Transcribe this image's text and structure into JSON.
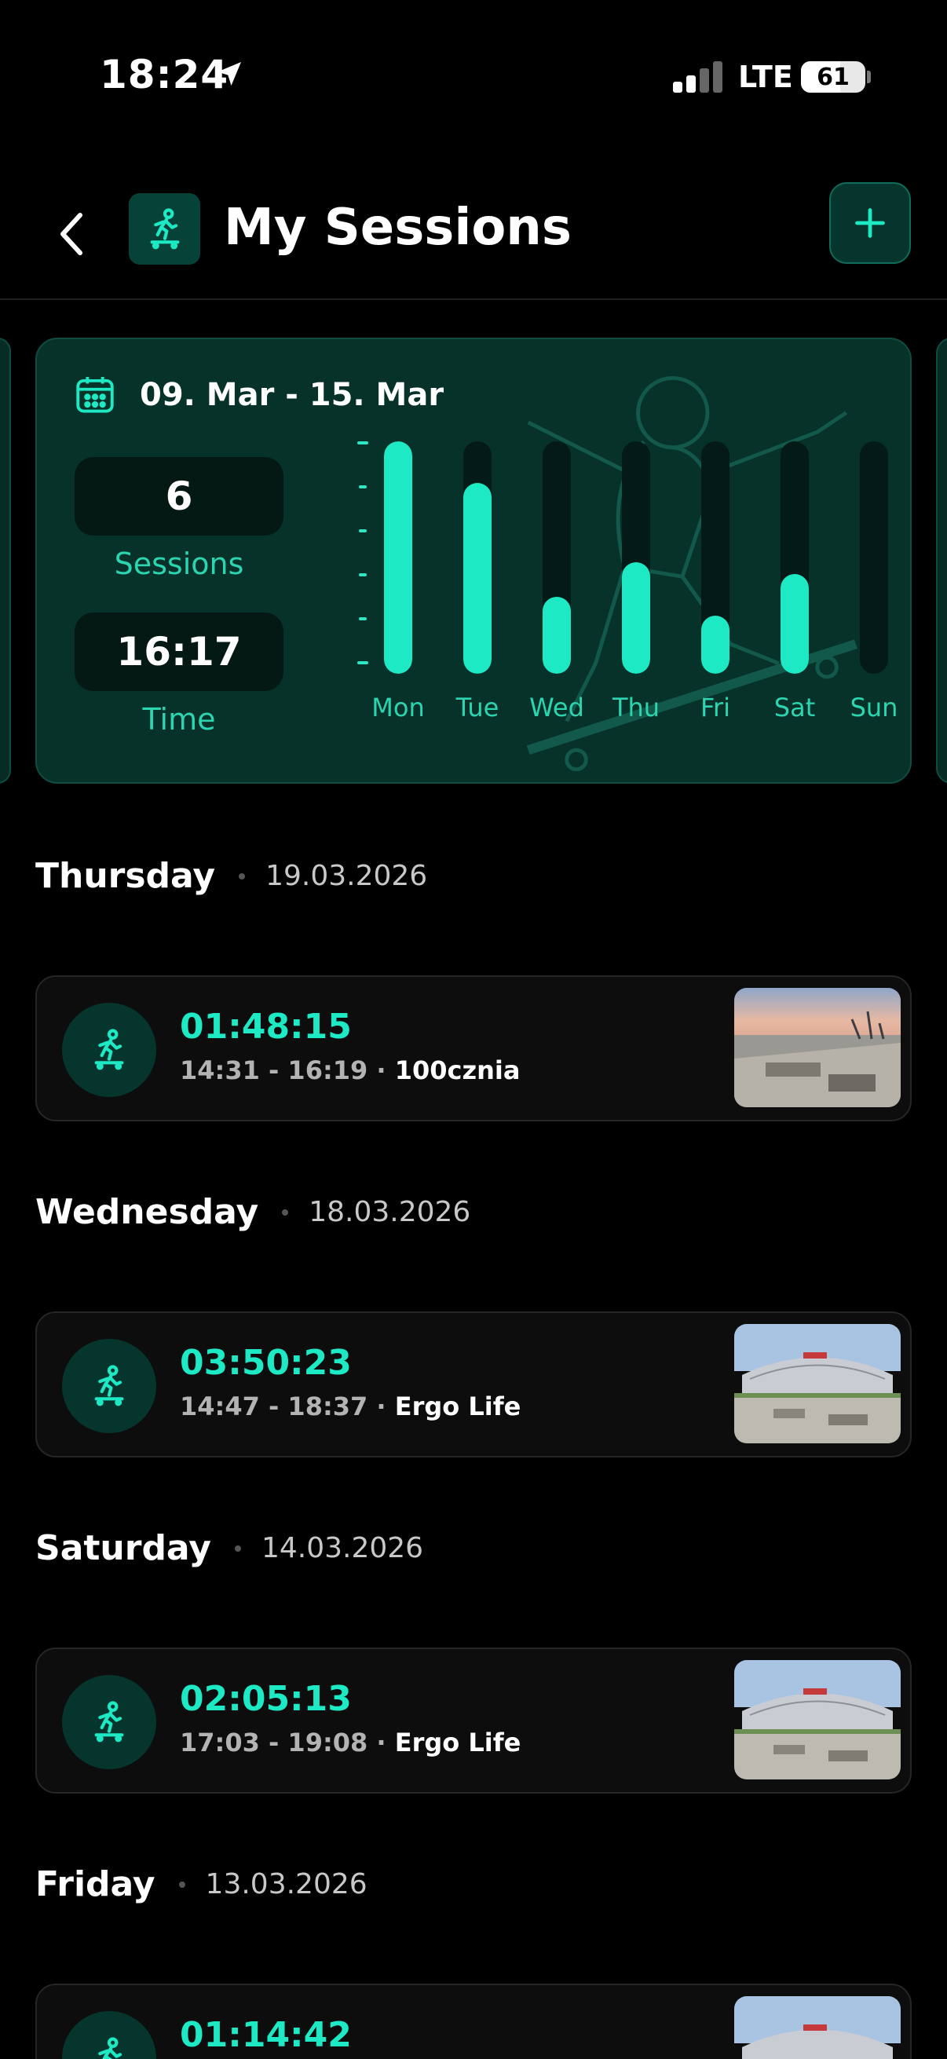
{
  "status_bar": {
    "time": "18:24",
    "network": "LTE",
    "battery": "61",
    "battery_level": 0.61,
    "icons": [
      "location-arrow-icon",
      "signal-bars-icon",
      "battery-icon"
    ]
  },
  "header": {
    "title": "My Sessions",
    "back_icon": "chevron-left-icon",
    "logo_icon": "skateboarder-icon",
    "add_icon": "plus-icon"
  },
  "summary": {
    "date_range": "09. Mar - 15. Mar",
    "calendar_icon": "calendar-icon",
    "sessions_value": "6",
    "sessions_label": "Sessions",
    "time_value": "16:17",
    "time_label": "Time"
  },
  "chart_data": {
    "type": "bar",
    "categories": [
      "Mon",
      "Tue",
      "Wed",
      "Thu",
      "Fri",
      "Sat",
      "Sun"
    ],
    "values": [
      1.0,
      0.82,
      0.33,
      0.48,
      0.25,
      0.43,
      0
    ],
    "ylim": [
      0,
      1
    ]
  },
  "sessions": [
    {
      "day": "Thursday",
      "date": "19.03.2026",
      "duration": "01:48:15",
      "range": "14:31 - 16:19 · ",
      "spot": "100cznia",
      "thumb": "waterfront-skatepark"
    },
    {
      "day": "Wednesday",
      "date": "18.03.2026",
      "duration": "03:50:23",
      "range": "14:47 - 18:37 · ",
      "spot": "Ergo Life",
      "thumb": "arena-skatepark"
    },
    {
      "day": "Saturday",
      "date": "14.03.2026",
      "duration": "02:05:13",
      "range": "17:03 - 19:08 · ",
      "spot": "Ergo Life",
      "thumb": "arena-skatepark"
    },
    {
      "day": "Friday",
      "date": "13.03.2026",
      "duration": "01:14:42",
      "range": "",
      "spot": "",
      "thumb": "arena-skatepark"
    }
  ],
  "colors": {
    "accent": "#1de9c5",
    "card_bg": "#06322a",
    "bar_track": "#041a16"
  }
}
